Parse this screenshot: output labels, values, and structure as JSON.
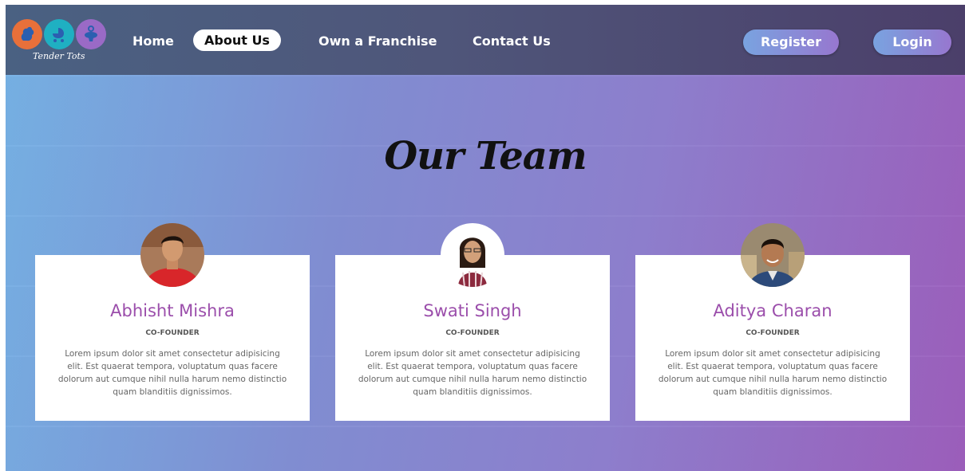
{
  "brand": {
    "name": "Tender Tots",
    "logo_colors": [
      "#e8703a",
      "#1fb0c2",
      "#9a6ac6"
    ]
  },
  "nav": {
    "links": [
      {
        "label": "Home",
        "active": false
      },
      {
        "label": "About Us",
        "active": true
      },
      {
        "label": "Own a Franchise",
        "active": false
      },
      {
        "label": "Contact Us",
        "active": false
      }
    ],
    "register_label": "Register",
    "login_label": "Login"
  },
  "team": {
    "title": "Our Team",
    "members": [
      {
        "name": "Abhisht Mishra",
        "role": "CO-FOUNDER",
        "description": "Lorem ipsum dolor sit amet consectetur adipisicing elit. Est quaerat tempora, voluptatum quas facere dolorum aut cumque nihil nulla harum nemo distinctio quam blanditiis dignissimos."
      },
      {
        "name": "Swati Singh",
        "role": "CO-FOUNDER",
        "description": "Lorem ipsum dolor sit amet consectetur adipisicing elit. Est quaerat tempora, voluptatum quas facere dolorum aut cumque nihil nulla harum nemo distinctio quam blanditiis dignissimos."
      },
      {
        "name": "Aditya Charan",
        "role": "CO-FOUNDER",
        "description": "Lorem ipsum dolor sit amet consectetur adipisicing elit. Est quaerat tempora, voluptatum quas facere dolorum aut cumque nihil nulla harum nemo distinctio quam blanditiis dignissimos."
      }
    ]
  },
  "colors": {
    "accent_name": "#9b4eab",
    "nav_bg": "#4f567a"
  }
}
